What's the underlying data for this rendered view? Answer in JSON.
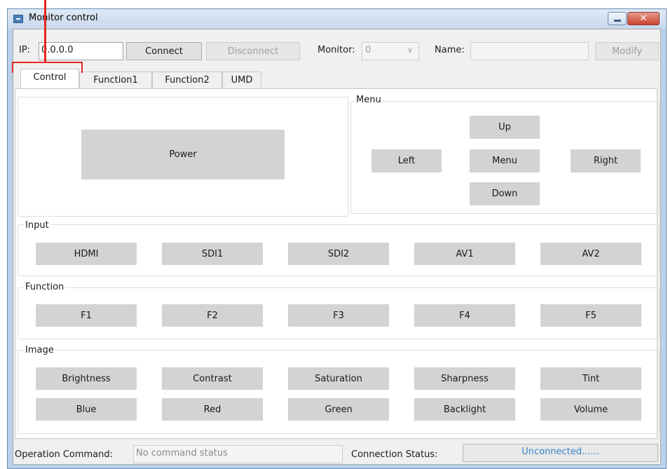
{
  "window": {
    "title": "Monitor control",
    "close_glyph": "✕"
  },
  "connection": {
    "ip_label": "IP:",
    "ip_value": "0.0.0.0",
    "connect_label": "Connect",
    "disconnect_label": "Disconnect",
    "monitor_label": "Monitor:",
    "monitor_value": "0",
    "name_label": "Name:",
    "name_value": "",
    "modify_label": "Modify"
  },
  "tabs": [
    {
      "label": "Control",
      "active": true
    },
    {
      "label": "Function1"
    },
    {
      "label": "Function2"
    },
    {
      "label": "UMD"
    }
  ],
  "control": {
    "power_label": "Power",
    "menu_group": "Menu",
    "menu_buttons": {
      "up": "Up",
      "left": "Left",
      "menu": "Menu",
      "right": "Right",
      "down": "Down"
    },
    "input_group": "Input",
    "input_buttons": [
      "HDMI",
      "SDI1",
      "SDI2",
      "AV1",
      "AV2"
    ],
    "function_group": "Function",
    "function_buttons": [
      "F1",
      "F2",
      "F3",
      "F4",
      "F5"
    ],
    "image_group": "Image",
    "image_row1": [
      "Brightness",
      "Contrast",
      "Saturation",
      "Sharpness",
      "Tint"
    ],
    "image_row2": [
      "Blue",
      "Red",
      "Green",
      "Backlight",
      "Volume"
    ]
  },
  "status": {
    "operation_label": "Operation Command:",
    "operation_value": "No command status",
    "connection_label": "Connection Status:",
    "connection_value": "Unconnected......"
  },
  "colors": {
    "highlight": "#e8261d",
    "status_text": "#3a86c8"
  }
}
